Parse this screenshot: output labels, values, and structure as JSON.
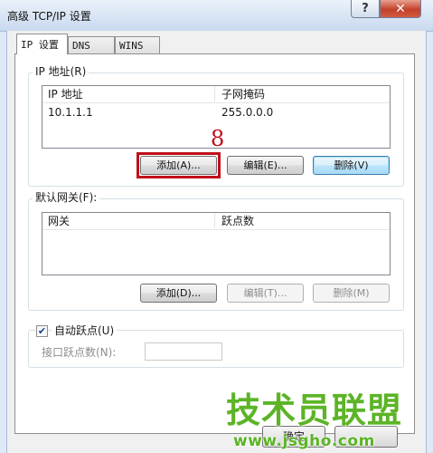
{
  "window": {
    "title": "高级 TCP/IP 设置",
    "help_label": "?",
    "close_label": "✕"
  },
  "tabs": [
    {
      "label": "IP 设置"
    },
    {
      "label": "DNS"
    },
    {
      "label": "WINS"
    }
  ],
  "ip_section": {
    "group_label": "IP 地址(R)",
    "columns": [
      "IP 地址",
      "子网掩码"
    ],
    "rows": [
      {
        "ip": "10.1.1.1",
        "mask": "255.0.0.0"
      }
    ],
    "add_button": "添加(A)...",
    "edit_button": "编辑(E)...",
    "delete_button": "删除(V)"
  },
  "annotation": {
    "step_number": "8",
    "highlight_color": "#c0101a"
  },
  "gateway_section": {
    "group_label": "默认网关(F):",
    "columns": [
      "网关",
      "跃点数"
    ],
    "add_button": "添加(D)...",
    "edit_button": "编辑(T)...",
    "delete_button": "删除(M)"
  },
  "metric": {
    "auto_metric_label": "自动跃点(U)",
    "auto_metric_checked": true,
    "check_glyph": "✔",
    "interface_metric_label": "接口跃点数(N):",
    "interface_metric_value": ""
  },
  "dialog_buttons": {
    "ok_partial": "确定"
  },
  "watermark": {
    "title": "技术员联盟",
    "url": "www.jsgho.com",
    "color": "#5cb426"
  }
}
